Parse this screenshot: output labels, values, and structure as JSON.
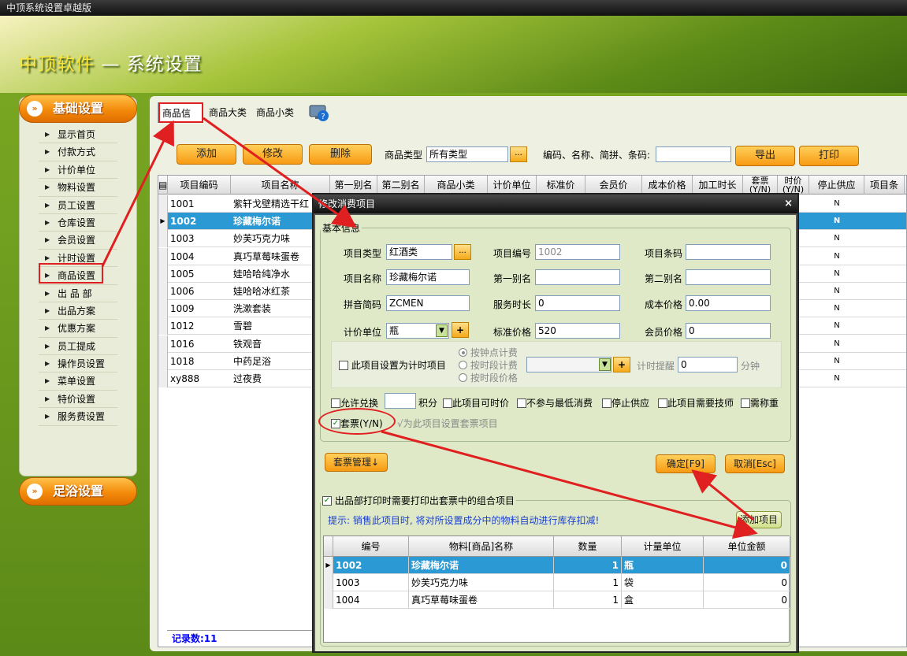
{
  "window": {
    "title": "中顶系统设置卓越版"
  },
  "app_header": {
    "brand": "中顶软件",
    "subtitle": "— 系统设置"
  },
  "sidebar": {
    "section1": "基础设置",
    "items": [
      "显示首页",
      "付款方式",
      "计价单位",
      "物料设置",
      "员工设置",
      "仓库设置",
      "会员设置",
      "计时设置",
      "商品设置",
      "出 品 部",
      "出品方案",
      "优惠方案",
      "员工提成",
      "操作员设置",
      "菜单设置",
      "特价设置",
      "服务费设置"
    ],
    "section2": "足浴设置"
  },
  "tabs": [
    "商品信息",
    "商品大类",
    "商品小类"
  ],
  "toolbar": {
    "add": "添加",
    "edit": "修改",
    "delete": "删除",
    "type_label": "商品类型",
    "type_value": "所有类型",
    "dots": "...",
    "search_label": "编码、名称、简拼、条码:",
    "search_value": "",
    "export": "导出",
    "print": "打印"
  },
  "grid": {
    "columns": [
      "项目编码",
      "项目名称",
      "第一别名",
      "第二别名",
      "商品小类",
      "计价单位",
      "标准价",
      "会员价",
      "成本价格",
      "加工时长",
      "套票(Y/N)",
      "时价(Y/N)",
      "停止供应",
      "项目条"
    ],
    "rows": [
      {
        "code": "1001",
        "name": "紫轩戈壁精选干红",
        "stop": "N"
      },
      {
        "code": "1002",
        "name": "珍藏梅尔诺",
        "stop": "N"
      },
      {
        "code": "1003",
        "name": "妙芙巧克力味",
        "stop": "N"
      },
      {
        "code": "1004",
        "name": "真巧草莓味蛋卷",
        "stop": "N"
      },
      {
        "code": "1005",
        "name": "娃哈哈纯净水",
        "stop": "N"
      },
      {
        "code": "1006",
        "name": "娃哈哈冰红茶",
        "stop": "N"
      },
      {
        "code": "1009",
        "name": "洗漱套装",
        "stop": "N"
      },
      {
        "code": "1012",
        "name": "雪碧",
        "stop": "N"
      },
      {
        "code": "1016",
        "name": "铁观音",
        "stop": "N"
      },
      {
        "code": "1018",
        "name": "中药足浴",
        "stop": "N"
      },
      {
        "code": "xy888",
        "name": "过夜费",
        "stop": "N"
      }
    ],
    "selected_index": 1,
    "record_count": "记录数:11"
  },
  "dialog": {
    "title": "修改消费项目",
    "close": "×",
    "basic_legend": "基本信息",
    "labels": {
      "type": "项目类型",
      "code": "项目编号",
      "barcode": "项目条码",
      "name": "项目名称",
      "alias1": "第一别名",
      "alias2": "第二别名",
      "pinyin": "拼音简码",
      "duration": "服务时长",
      "cost": "成本价格",
      "unit": "计价单位",
      "std_price": "标准价格",
      "member_price": "会员价格"
    },
    "values": {
      "type": "红酒类",
      "code": "1002",
      "barcode": "",
      "name": "珍藏梅尔诺",
      "alias1": "",
      "alias2": "",
      "pinyin": "ZCMEN",
      "duration": "0",
      "cost": "0.00",
      "unit": "瓶",
      "std_price": "520",
      "member_price": "0"
    },
    "timed": {
      "checkbox": "此项目设置为计时项目",
      "radio1": "按钟点计费",
      "radio2": "按时段计费",
      "radio3": "按时段价格",
      "remind_label": "计时提醒",
      "remind_value": "0",
      "unit": "分钟"
    },
    "options": {
      "exchange": "允许兑换",
      "points_label": "积分",
      "points_value": "",
      "time_price": "此项目可时价",
      "no_min": "不参与最低消费",
      "stop": "停止供应",
      "need_tech": "此项目需要技师",
      "weigh": "需称重"
    },
    "package": {
      "checkbox": "套票(Y/N)",
      "checked": true,
      "hint": "√为此项目设置套票项目"
    },
    "buttons": {
      "package_mgmt": "套票管理↓",
      "ok": "确定[F9]",
      "cancel": "取消[Esc]"
    },
    "combo": {
      "checkbox": "出品部打印时需要打印出套票中的组合项目",
      "hint": "提示: 销售此项目时, 将对所设置成分中的物料自动进行库存扣减!",
      "add_btn": "添加项目",
      "columns": [
        "编号",
        "物料[商品]名称",
        "数量",
        "计量单位",
        "单位金额"
      ],
      "rows": [
        {
          "code": "1002",
          "name": "珍藏梅尔诺",
          "qty": "1",
          "unit": "瓶",
          "amount": "0"
        },
        {
          "code": "1003",
          "name": "妙芙巧克力味",
          "qty": "1",
          "unit": "袋",
          "amount": "0"
        },
        {
          "code": "1004",
          "name": "真巧草莓味蛋卷",
          "qty": "1",
          "unit": "盒",
          "amount": "0"
        }
      ]
    }
  }
}
